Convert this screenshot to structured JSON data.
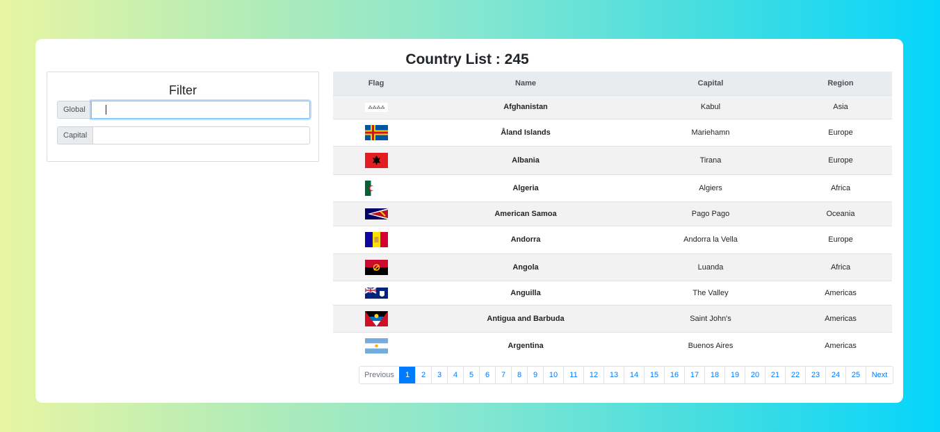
{
  "page_title": "Country List : 245",
  "filter": {
    "title": "Filter",
    "global_label": "Global",
    "global_value": "",
    "capital_label": "Capital",
    "capital_value": ""
  },
  "table": {
    "headers": [
      "Flag",
      "Name",
      "Capital",
      "Region"
    ],
    "rows": [
      {
        "flag": "afghanistan-flag",
        "name": "Afghanistan",
        "capital": "Kabul",
        "region": "Asia"
      },
      {
        "flag": "aland-flag",
        "name": "Åland Islands",
        "capital": "Mariehamn",
        "region": "Europe"
      },
      {
        "flag": "albania-flag",
        "name": "Albania",
        "capital": "Tirana",
        "region": "Europe"
      },
      {
        "flag": "algeria-flag",
        "name": "Algeria",
        "capital": "Algiers",
        "region": "Africa"
      },
      {
        "flag": "american-samoa-flag",
        "name": "American Samoa",
        "capital": "Pago Pago",
        "region": "Oceania"
      },
      {
        "flag": "andorra-flag",
        "name": "Andorra",
        "capital": "Andorra la Vella",
        "region": "Europe"
      },
      {
        "flag": "angola-flag",
        "name": "Angola",
        "capital": "Luanda",
        "region": "Africa"
      },
      {
        "flag": "anguilla-flag",
        "name": "Anguilla",
        "capital": "The Valley",
        "region": "Americas"
      },
      {
        "flag": "antigua-flag",
        "name": "Antigua and Barbuda",
        "capital": "Saint John's",
        "region": "Americas"
      },
      {
        "flag": "argentina-flag",
        "name": "Argentina",
        "capital": "Buenos Aires",
        "region": "Americas"
      }
    ]
  },
  "pagination": {
    "previous": "Previous",
    "next": "Next",
    "pages": [
      "1",
      "2",
      "3",
      "4",
      "5",
      "6",
      "7",
      "8",
      "9",
      "10",
      "11",
      "12",
      "13",
      "14",
      "15",
      "16",
      "17",
      "18",
      "19",
      "20",
      "21",
      "22",
      "23",
      "24",
      "25"
    ],
    "current": "1"
  },
  "colors": {
    "accent": "#007bff",
    "header_bg": "#e9ecef",
    "stripe_bg": "#f2f2f2"
  }
}
